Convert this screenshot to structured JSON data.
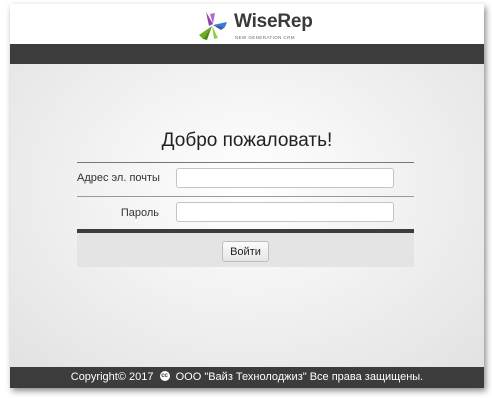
{
  "header": {
    "logo_name": "WiseRep",
    "logo_tagline": "NEW GENERATION CRM"
  },
  "main": {
    "title": "Добро пожаловать!",
    "form": {
      "email_label": "Адрес эл. почты",
      "email_value": "",
      "password_label": "Пароль",
      "password_value": "",
      "submit_label": "Войти"
    }
  },
  "footer": {
    "copyright_prefix": "Copyright© 2017",
    "cc_icon_glyph": "cc",
    "company_text": "ООО \"Вайз Технолоджиз\" Все права защищены."
  },
  "colors": {
    "dark_bar": "#3c3c3c",
    "logo_blue": "#3a7bd5",
    "logo_purple": "#8e44ad",
    "logo_green": "#6ab023"
  }
}
